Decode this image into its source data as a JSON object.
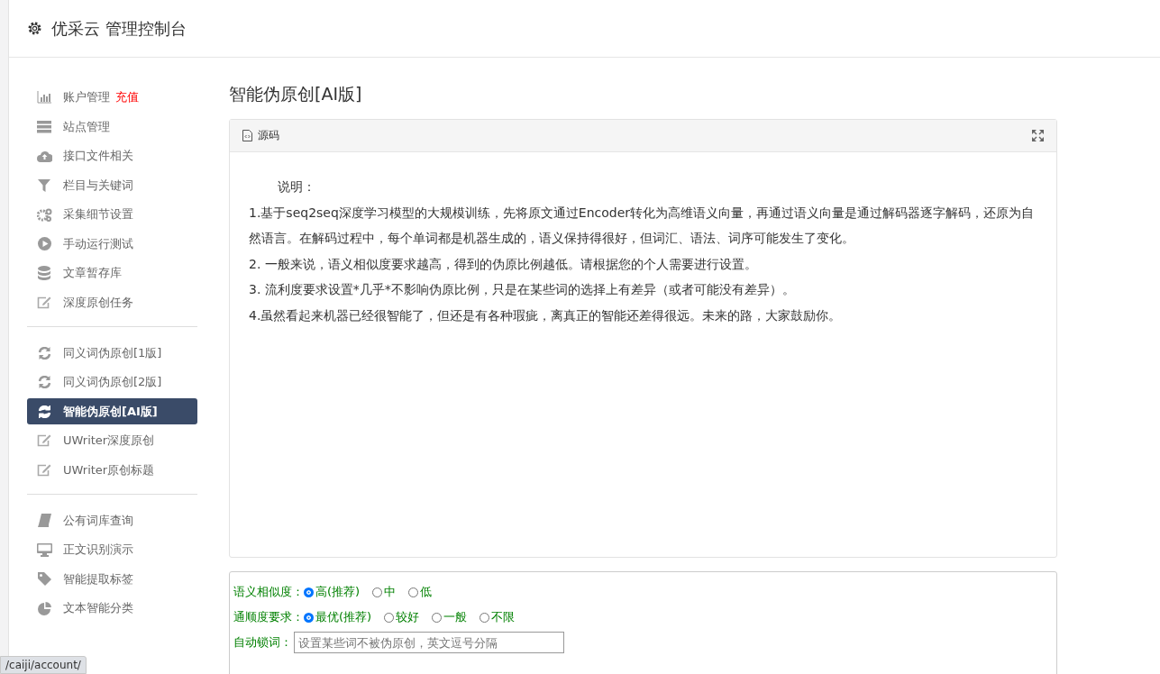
{
  "header": {
    "title": "优采云 管理控制台"
  },
  "sidebar": {
    "groups": [
      [
        {
          "label": "账户管理",
          "badge": "充值",
          "selected": false
        },
        {
          "label": "站点管理",
          "selected": false
        },
        {
          "label": "接口文件相关",
          "selected": false
        },
        {
          "label": "栏目与关键词",
          "selected": false
        },
        {
          "label": "采集细节设置",
          "selected": false
        },
        {
          "label": "手动运行测试",
          "selected": false
        },
        {
          "label": "文章暂存库",
          "selected": false
        },
        {
          "label": "深度原创任务",
          "selected": false
        }
      ],
      [
        {
          "label": "同义词伪原创[1版]",
          "selected": false
        },
        {
          "label": "同义词伪原创[2版]",
          "selected": false
        },
        {
          "label": "智能伪原创[AI版]",
          "selected": true
        },
        {
          "label": "UWriter深度原创",
          "selected": false
        },
        {
          "label": "UWriter原创标题",
          "selected": false
        }
      ],
      [
        {
          "label": "公有词库查询",
          "selected": false
        },
        {
          "label": "正文识别演示",
          "selected": false
        },
        {
          "label": "智能提取标签",
          "selected": false
        },
        {
          "label": "文本智能分类",
          "selected": false
        }
      ]
    ]
  },
  "main": {
    "title": "智能伪原创[AI版]",
    "editor": {
      "toolbar_label": "源码",
      "heading": "说明：",
      "paragraphs": [
        "1.基于seq2seq深度学习模型的大规模训练，先将原文通过Encoder转化为高维语义向量，再通过语义向量是通过解码器逐字解码，还原为自然语言。在解码过程中，每个单词都是机器生成的，语义保持得很好，但词汇、语法、词序可能发生了变化。",
        "2. 一般来说，语义相似度要求越高，得到的伪原比例越低。请根据您的个人需要进行设置。",
        "3. 流利度要求设置*几乎*不影响伪原比例，只是在某些词的选择上有差异（或者可能没有差异）。",
        "4.虽然看起来机器已经很智能了，但还是有各种瑕疵，离真正的智能还差得很远。未来的路，大家鼓励你。"
      ]
    },
    "options": [
      {
        "label": "语义相似度：",
        "choices": [
          {
            "label": "高(推荐)",
            "selected": true
          },
          {
            "label": "中",
            "selected": false
          },
          {
            "label": "低",
            "selected": false
          }
        ]
      },
      {
        "label": "通顺度要求：",
        "choices": [
          {
            "label": "最优(推荐)",
            "selected": true
          },
          {
            "label": "较好",
            "selected": false
          },
          {
            "label": "一般",
            "selected": false
          },
          {
            "label": "不限",
            "selected": false
          }
        ]
      }
    ],
    "lock_words": {
      "label": "自动锁词：",
      "placeholder": "设置某些词不被伪原创，英文逗号分隔"
    }
  },
  "status_bar": {
    "url": "/caiji/account/"
  }
}
